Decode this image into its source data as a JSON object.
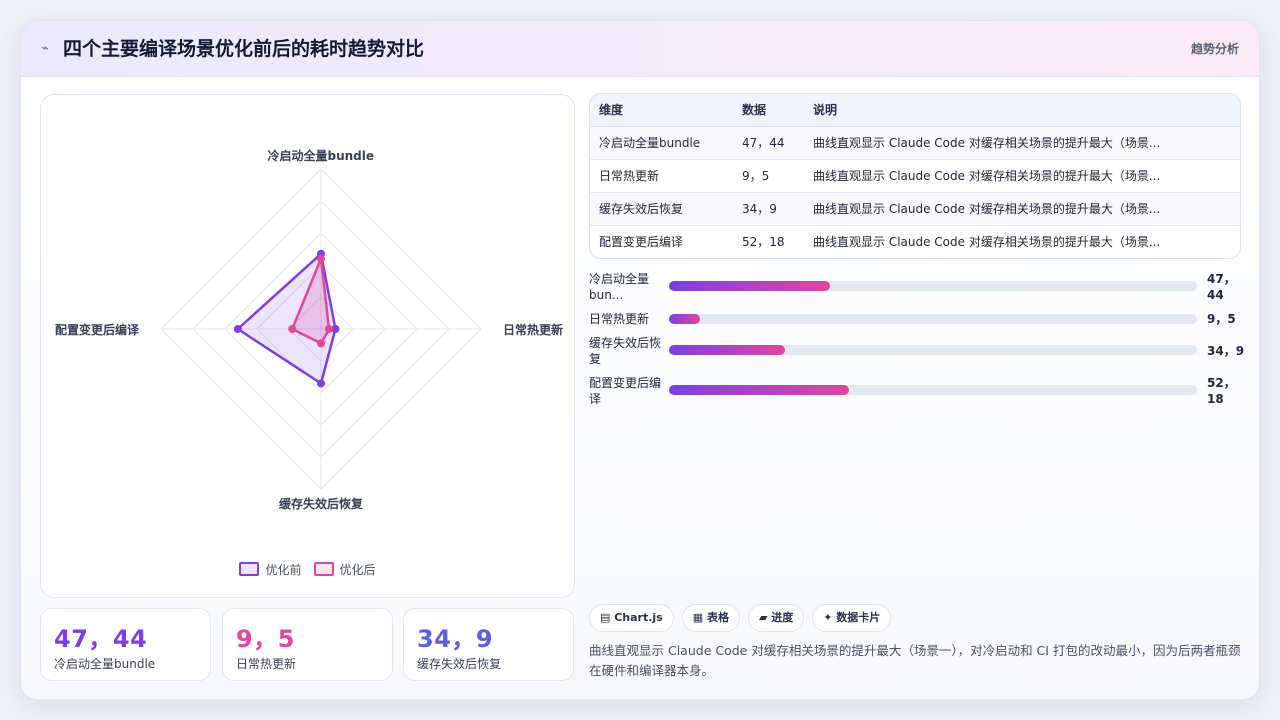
{
  "header": {
    "icon": "wave-icon",
    "title": "四个主要编译场景优化前后的耗时趋势对比",
    "right_label": "趋势分析"
  },
  "chart_data": {
    "type": "radar",
    "axes": [
      "冷启动全量bundle",
      "日常热更新",
      "缓存失效后恢复",
      "配置变更后编译"
    ],
    "series": [
      {
        "name": "优化前",
        "values": [
          47,
          9,
          34,
          52
        ],
        "color": "#7b3fe4"
      },
      {
        "name": "优化后",
        "values": [
          44,
          5,
          9,
          18
        ],
        "color": "#e0479e"
      }
    ],
    "rmax": 100,
    "grid_levels": 5,
    "legend": "bottom"
  },
  "legend": [
    {
      "label": "优化前",
      "color": "#7b3fe4"
    },
    {
      "label": "优化后",
      "color": "#e0479e"
    }
  ],
  "stats": [
    {
      "value": "47，44",
      "label": "冷启动全量bundle",
      "color": "#7b3fe4"
    },
    {
      "value": "9，5",
      "label": "日常热更新",
      "color": "#e0479e"
    },
    {
      "value": "34，9",
      "label": "缓存失效后恢复",
      "color": "#5b5ee0"
    }
  ],
  "table": {
    "headers": [
      "维度",
      "数据",
      "说明"
    ],
    "rows": [
      [
        "冷启动全量bundle",
        "47，44",
        "曲线直观显示 Claude Code 对缓存相关场景的提升最大（场景..."
      ],
      [
        "日常热更新",
        "9，5",
        "曲线直观显示 Claude Code 对缓存相关场景的提升最大（场景..."
      ],
      [
        "缓存失效后恢复",
        "34，9",
        "曲线直观显示 Claude Code 对缓存相关场景的提升最大（场景..."
      ],
      [
        "配置变更后编译",
        "52，18",
        "曲线直观显示 Claude Code 对缓存相关场景的提升最大（场景..."
      ]
    ]
  },
  "bars": [
    {
      "label": "冷启动全量bun...",
      "value": "47，44",
      "fraction": 0.305
    },
    {
      "label": "日常热更新",
      "value": "9，5",
      "fraction": 0.058
    },
    {
      "label": "缓存失效后恢复",
      "value": "34，9",
      "fraction": 0.22
    },
    {
      "label": "配置变更后编译",
      "value": "52，18",
      "fraction": 0.34
    }
  ],
  "chips": [
    "▤ Chart.js",
    "▦ 表格",
    "▰ 进度",
    "✦ 数据卡片"
  ],
  "note": "曲线直观显示 Claude Code 对缓存相关场景的提升最大（场景一），对冷启动和 CI 打包的改动最小，因为后两者瓶颈在硬件和编译器本身。"
}
